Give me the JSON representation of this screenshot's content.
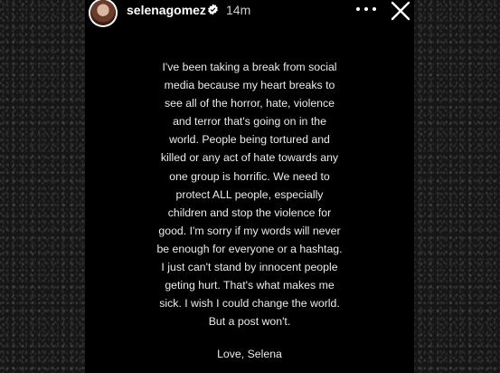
{
  "story": {
    "username": "selenagomez",
    "time_ago": "14m",
    "verified_icon": "verified-badge-icon",
    "more_icon": "more-horizontal-icon",
    "close_icon": "close-icon",
    "message": "I've been taking a break from social\nmedia because my heart breaks to\nsee all of the horror, hate, violence\nand terror that's going on in the\nworld. People being tortured and\nkilled or any act of hate towards any\none group is horrific. We need to\nprotect ALL people, especially\nchildren and stop the violence for\ngood.  I'm sorry if my words will never\nbe enough for everyone or a hashtag.\nI just can't stand by innocent people\ngeting hurt. That's what makes me\nsick. I wish I could change the world.\nBut a post won't.",
    "signoff": "Love, Selena"
  },
  "colors": {
    "story_background": "#000000",
    "text": "#ececec",
    "verified_badge": "#3897f0"
  }
}
